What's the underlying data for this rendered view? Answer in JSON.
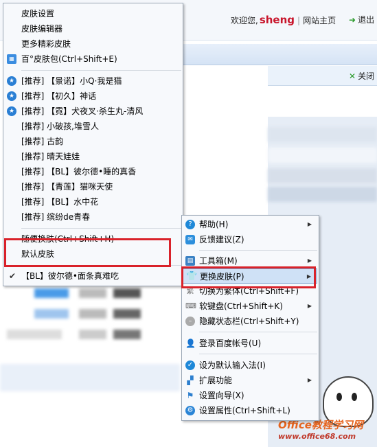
{
  "header": {
    "welcome": "欢迎您,",
    "username": "sheng",
    "separator": "|",
    "site_home": "网站主页",
    "exit": "退出"
  },
  "panel": {
    "close": "关闭"
  },
  "skin_menu": {
    "items": [
      {
        "label": "皮肤设置"
      },
      {
        "label": "皮肤编辑器"
      },
      {
        "label": "更多精彩皮肤"
      },
      {
        "label": "百°皮肤包(Ctrl+Shift+E)",
        "icon": "skin-pack-icon"
      }
    ],
    "recommended": [
      {
        "label": "[推荐] 【景诺】小Q·我是猫",
        "icon": "star-icon"
      },
      {
        "label": "[推荐] 【初久】神话",
        "icon": "star-icon"
      },
      {
        "label": "[推荐] 【霓】犬夜叉·杀生丸-清风",
        "icon": "star-icon"
      },
      {
        "label": "[推荐] 小破孩,堆雪人"
      },
      {
        "label": "[推荐] 古韵"
      },
      {
        "label": "[推荐] 晴天娃娃"
      },
      {
        "label": "[推荐] 【BL】彼尔德•睡的真香"
      },
      {
        "label": "[推荐] 【青莲】猫咪天使"
      },
      {
        "label": "[推荐] 【BL】水中花"
      },
      {
        "label": "[推荐] 缤纷de青春"
      }
    ],
    "random": "随便换肤(Ctrl+Shift+H)",
    "default": "默认皮肤",
    "current": "【BL】彼尔德•面条真难吃"
  },
  "main_menu": {
    "items": [
      {
        "label": "帮助(H)",
        "icon": "help-icon",
        "submenu": true
      },
      {
        "label": "反馈建议(Z)",
        "icon": "feedback-icon"
      },
      {
        "label": "工具箱(M)",
        "icon": "toolbox-icon",
        "submenu": true
      },
      {
        "label": "更换皮肤(P)",
        "icon": "skin-icon",
        "submenu": true,
        "active": true
      },
      {
        "label": "切换为繁体(Ctrl+Shift+F)",
        "icon": "traditional-icon"
      },
      {
        "label": "软键盘(Ctrl+Shift+K)",
        "icon": "keyboard-icon",
        "submenu": true
      },
      {
        "label": "隐藏状态栏(Ctrl+Shift+Y)",
        "icon": "hide-icon"
      },
      {
        "label": "登录百度帐号(U)",
        "icon": "user-icon"
      },
      {
        "label": "设为默认输入法(I)",
        "icon": "check-circle-icon"
      },
      {
        "label": "扩展功能",
        "icon": "extension-icon",
        "submenu": true
      },
      {
        "label": "设置向导(X)",
        "icon": "flag-icon"
      },
      {
        "label": "设置属性(Ctrl+Shift+L)",
        "icon": "settings-icon"
      }
    ]
  },
  "watermark": {
    "title": "Office教程学习网",
    "url": "www.office68.com"
  },
  "colors": {
    "highlight_box": "#d9222a",
    "menu_active": "#cfe1f6"
  }
}
